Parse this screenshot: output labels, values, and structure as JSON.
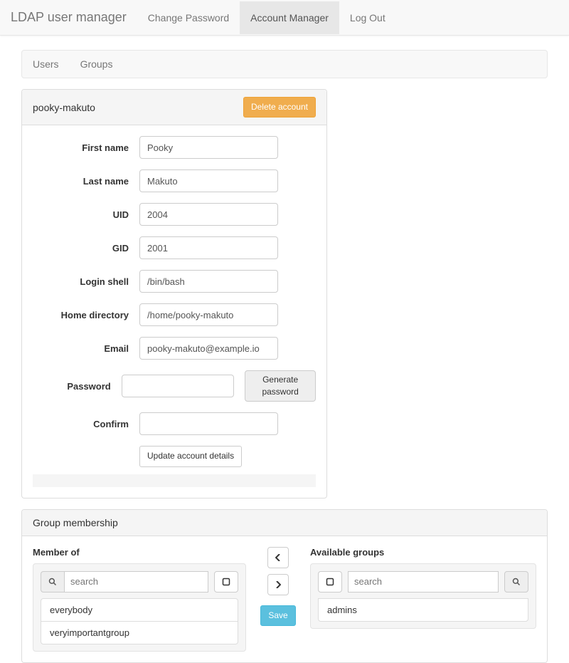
{
  "nav": {
    "brand": "LDAP user manager",
    "items": [
      {
        "label": "Change Password",
        "active": false
      },
      {
        "label": "Account Manager",
        "active": true
      },
      {
        "label": "Log Out",
        "active": false
      }
    ]
  },
  "subnav": {
    "items": [
      {
        "label": "Users"
      },
      {
        "label": "Groups"
      }
    ]
  },
  "account": {
    "username": "pooky-makuto",
    "delete_label": "Delete account",
    "fields": {
      "first_name": {
        "label": "First name",
        "value": "Pooky"
      },
      "last_name": {
        "label": "Last name",
        "value": "Makuto"
      },
      "uid": {
        "label": "UID",
        "value": "2004"
      },
      "gid": {
        "label": "GID",
        "value": "2001"
      },
      "login_shell": {
        "label": "Login shell",
        "value": "/bin/bash"
      },
      "home_dir": {
        "label": "Home directory",
        "value": "/home/pooky-makuto"
      },
      "email": {
        "label": "Email",
        "value": "pooky-makuto@example.io"
      },
      "password": {
        "label": "Password",
        "value": ""
      },
      "confirm": {
        "label": "Confirm",
        "value": ""
      }
    },
    "generate_password_label": "Generate password",
    "update_label": "Update account details"
  },
  "groups": {
    "panel_title": "Group membership",
    "member_of_label": "Member of",
    "available_label": "Available groups",
    "search_placeholder": "search",
    "save_label": "Save",
    "member_of": [
      "everybody",
      "veryimportantgroup"
    ],
    "available": [
      "admins"
    ]
  }
}
